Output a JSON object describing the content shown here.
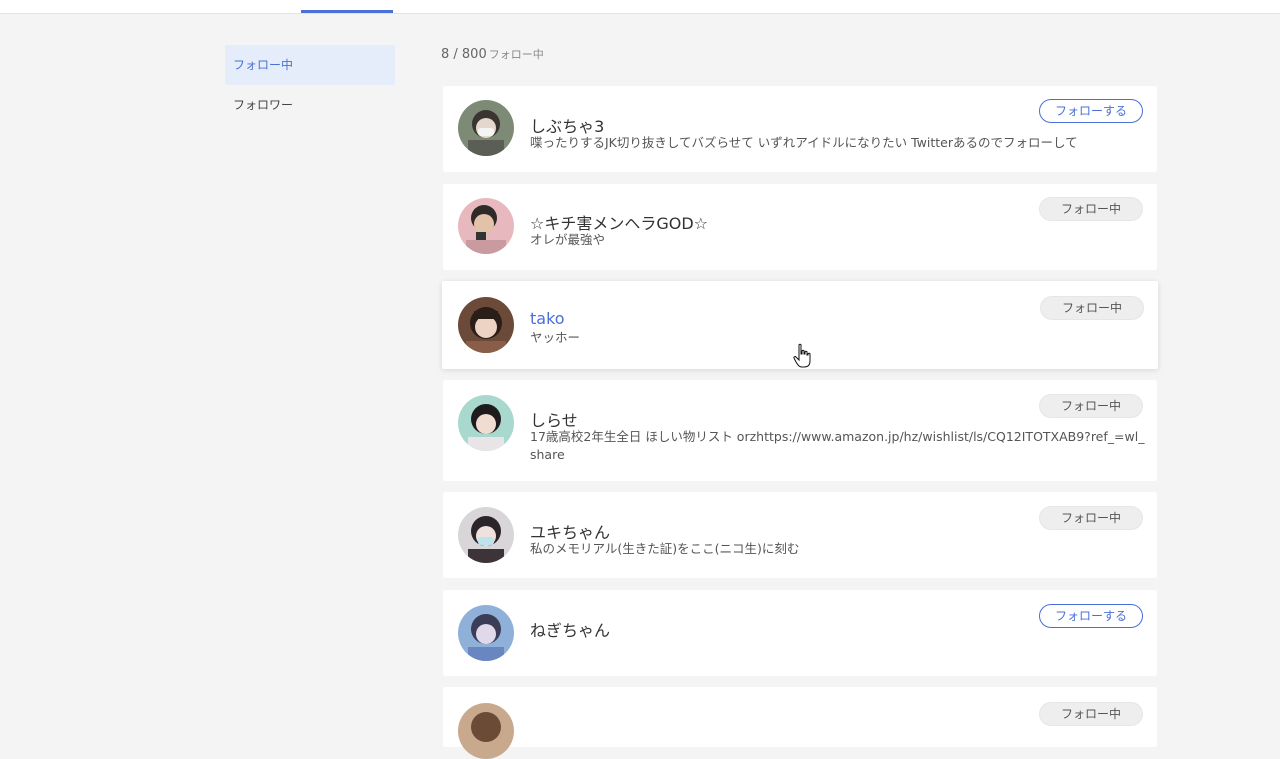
{
  "sidebar": {
    "items": [
      {
        "label": "フォロー中",
        "active": true
      },
      {
        "label": "フォロワー",
        "active": false
      }
    ]
  },
  "summary": {
    "count": "8 / 800",
    "suffix": "フォロー中"
  },
  "users": [
    {
      "name": "しぶちゃ3",
      "bio": "喋ったりするJK切り抜きしてバズらせて いずれアイドルになりたい Twitterあるのでフォローして",
      "button": "フォローする",
      "following": false
    },
    {
      "name": "☆キチ害メンヘラGOD☆",
      "bio": "オレが最強や",
      "button": "フォロー中",
      "following": true
    },
    {
      "name": "tako",
      "bio": "ヤッホー",
      "button": "フォロー中",
      "following": true
    },
    {
      "name": "しらせ",
      "bio": "17歳高校2年生全日 ほしい物リスト orzhttps://www.amazon.jp/hz/wishlist/ls/CQ12ITOTXAB9?ref_=wl_share",
      "button": "フォロー中",
      "following": true
    },
    {
      "name": "ユキちゃん",
      "bio": "私のメモリアル(生きた証)をここ(ニコ生)に刻む",
      "button": "フォロー中",
      "following": true
    },
    {
      "name": "ねぎちゃん",
      "bio": "",
      "button": "フォローする",
      "following": false
    },
    {
      "name": "",
      "bio": "",
      "button": "フォロー中",
      "following": true
    }
  ],
  "colors": {
    "accent": "#4a6fd6",
    "active_bg": "#e5edfb",
    "page_bg": "#f4f4f4"
  }
}
